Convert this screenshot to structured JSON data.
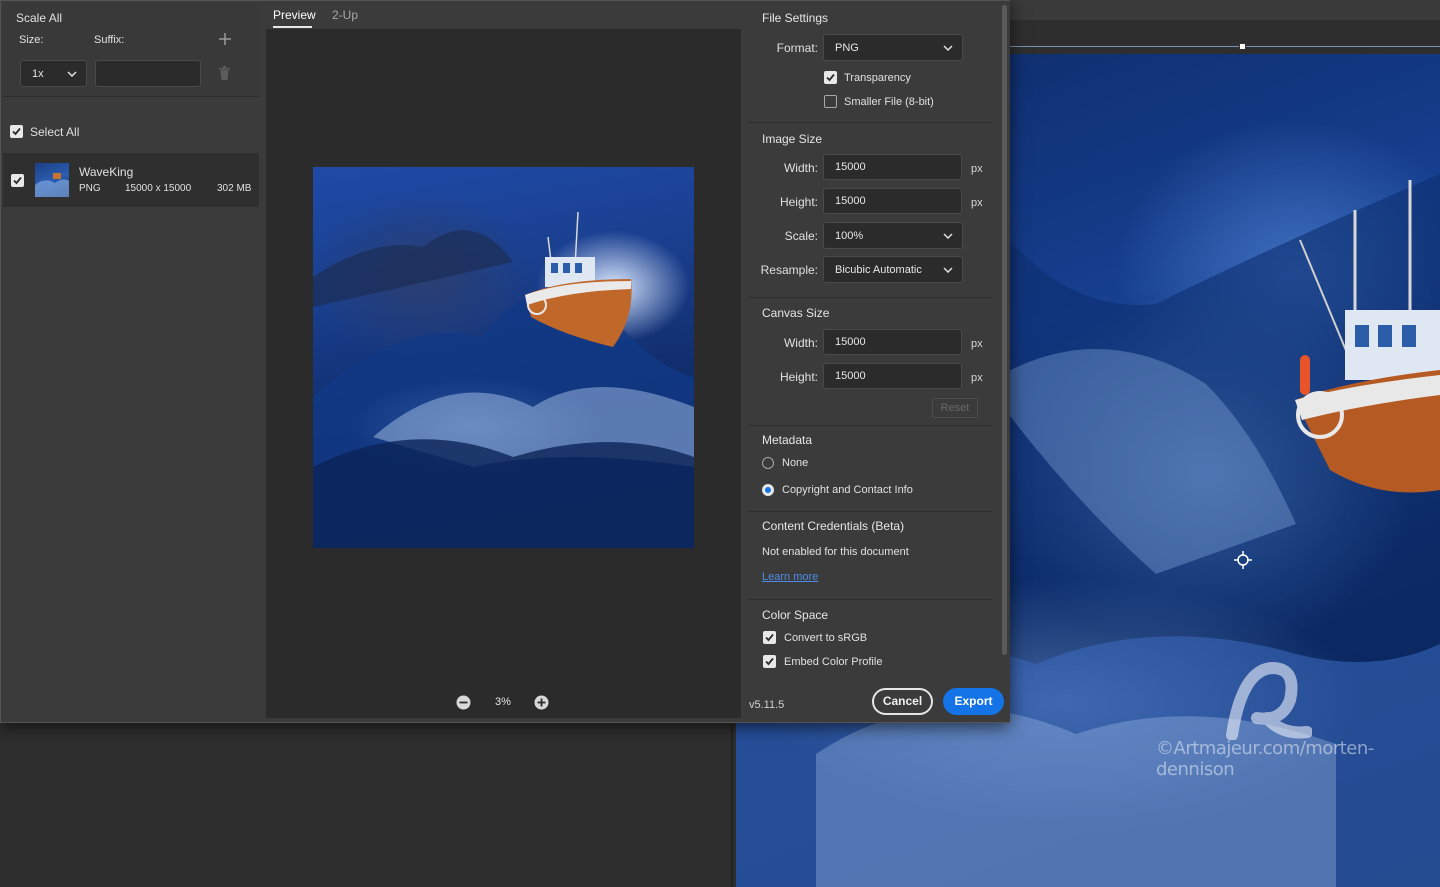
{
  "left_panel": {
    "scale_all_label": "Scale All",
    "size_label": "Size:",
    "suffix_label": "Suffix:",
    "size_value": "1x",
    "suffix_value": "",
    "select_all_label": "Select All",
    "asset": {
      "name": "WaveKing",
      "format": "PNG",
      "dimensions": "15000 x 15000",
      "file_size": "302 MB",
      "checked": true
    }
  },
  "preview_panel": {
    "tabs": [
      {
        "label": "Preview",
        "active": true
      },
      {
        "label": "2-Up",
        "active": false
      }
    ],
    "zoom_level": "3%"
  },
  "settings": {
    "file_settings": {
      "title": "File Settings",
      "format_label": "Format:",
      "format_value": "PNG",
      "transparency_label": "Transparency",
      "transparency_checked": true,
      "smaller_file_label": "Smaller File (8-bit)",
      "smaller_file_checked": false
    },
    "image_size": {
      "title": "Image Size",
      "width_label": "Width:",
      "width_value": "15000",
      "height_label": "Height:",
      "height_value": "15000",
      "scale_label": "Scale:",
      "scale_value": "100%",
      "resample_label": "Resample:",
      "resample_value": "Bicubic Automatic",
      "unit": "px"
    },
    "canvas_size": {
      "title": "Canvas Size",
      "width_label": "Width:",
      "width_value": "15000",
      "height_label": "Height:",
      "height_value": "15000",
      "unit": "px",
      "reset_label": "Reset"
    },
    "metadata": {
      "title": "Metadata",
      "options": [
        {
          "label": "None",
          "selected": false
        },
        {
          "label": "Copyright and Contact Info",
          "selected": true
        }
      ]
    },
    "content_credentials": {
      "title": "Content Credentials (Beta)",
      "status": "Not enabled for this document",
      "link": "Learn more"
    },
    "color_space": {
      "title": "Color Space",
      "convert_label": "Convert to sRGB",
      "convert_checked": true,
      "embed_label": "Embed Color Profile",
      "embed_checked": true
    }
  },
  "footer": {
    "version": "v5.11.5",
    "cancel_label": "Cancel",
    "export_label": "Export"
  },
  "background": {
    "watermark": "©Artmajeur.com/morten-dennison"
  },
  "colors": {
    "accent": "#1473e6",
    "panel_bg": "#3b3b3b",
    "preview_bg": "#2b2b2b",
    "link": "#4d8ce8"
  }
}
